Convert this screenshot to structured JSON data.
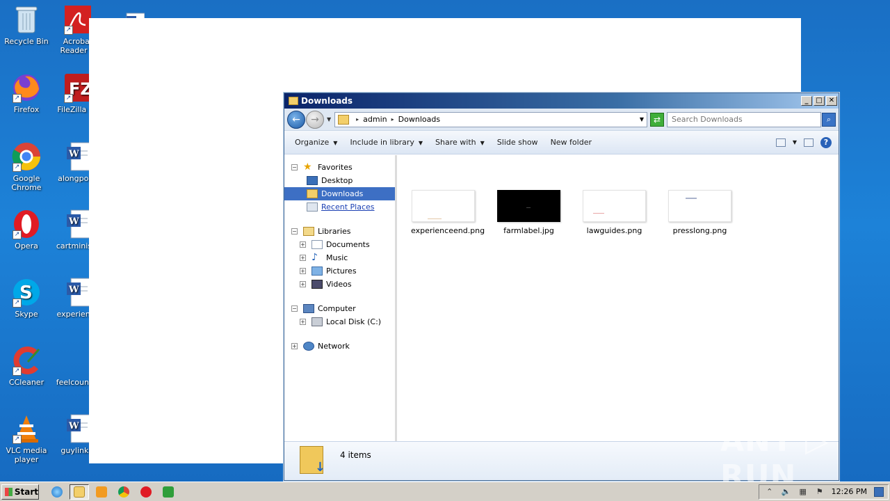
{
  "desktop": {
    "icons": [
      {
        "label": "Recycle Bin"
      },
      {
        "label": "Acrobat Reader D"
      },
      {
        "label": "Firefox"
      },
      {
        "label": "FileZilla Cli"
      },
      {
        "label": "Google Chrome"
      },
      {
        "label": "alongpoliti"
      },
      {
        "label": "Opera"
      },
      {
        "label": "cartministe"
      },
      {
        "label": "Skype"
      },
      {
        "label": "experience"
      },
      {
        "label": "CCleaner"
      },
      {
        "label": "feelcountry"
      },
      {
        "label": "VLC media player"
      },
      {
        "label": "guylinks."
      }
    ]
  },
  "window": {
    "title": "Downloads",
    "minimize": "_",
    "maximize": "□",
    "close": "✕"
  },
  "address": {
    "crumbs": [
      "admin",
      "Downloads"
    ],
    "search_placeholder": "Search Downloads"
  },
  "toolbar": {
    "organize": "Organize",
    "include_in_library": "Include in library",
    "share_with": "Share with",
    "slide_show": "Slide show",
    "new_folder": "New folder"
  },
  "nav": {
    "favorites": "Favorites",
    "desktop": "Desktop",
    "downloads": "Downloads",
    "recent_places": "Recent Places",
    "libraries": "Libraries",
    "documents": "Documents",
    "music": "Music",
    "pictures": "Pictures",
    "videos": "Videos",
    "computer": "Computer",
    "local_disk": "Local Disk (C:)",
    "network": "Network"
  },
  "files": [
    {
      "name": "experienceend.png"
    },
    {
      "name": "farmlabel.jpg"
    },
    {
      "name": "lawguides.png"
    },
    {
      "name": "presslong.png"
    }
  ],
  "details": {
    "count": "4 items"
  },
  "watermark": "ANY ▷ RUN",
  "taskbar": {
    "start": "Start",
    "time": "12:26 PM"
  },
  "colors": {
    "desktop_bg": "#1d82d8",
    "selection": "#3d6fc4",
    "title_bar": "#0a246a"
  }
}
